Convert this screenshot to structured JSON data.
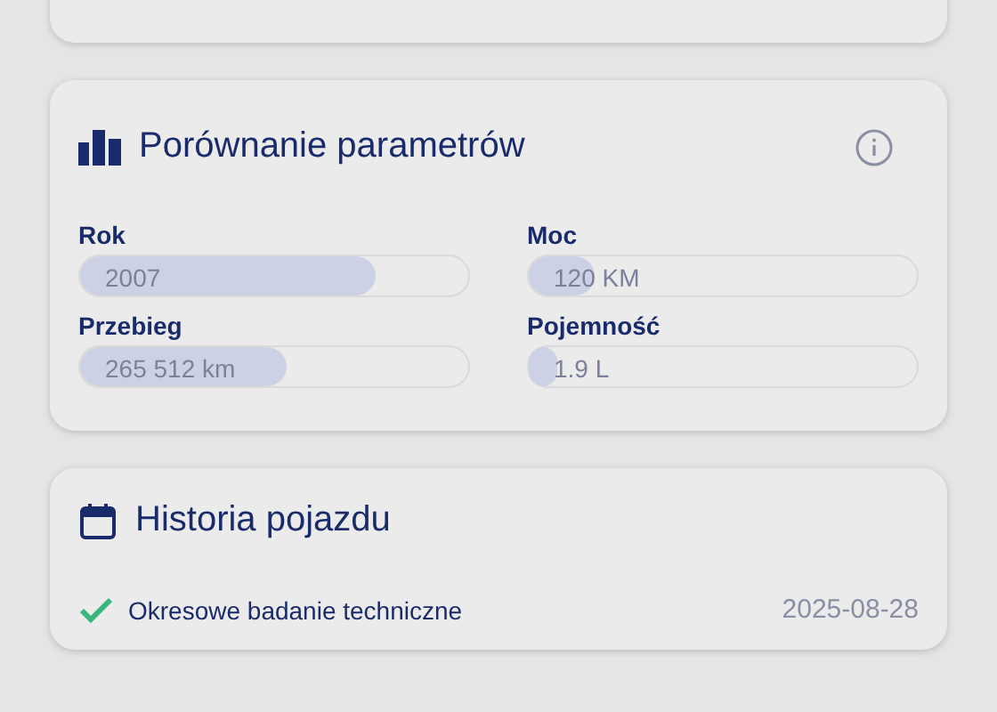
{
  "comparison": {
    "title": "Porównanie parametrów",
    "params": [
      {
        "label": "Rok",
        "value": "2007",
        "level": 0.76
      },
      {
        "label": "Moc",
        "value": "120 KM",
        "level": 0.17
      },
      {
        "label": "Przebieg",
        "value": "265 512 km",
        "level": 0.53
      },
      {
        "label": "Pojemność",
        "value": "1.9 L",
        "level": 0.07
      }
    ]
  },
  "history": {
    "title": "Historia pojazdu",
    "events": [
      {
        "label": "Okresowe badanie techniczne",
        "date": "2025-08-28",
        "kind": "done"
      }
    ]
  }
}
